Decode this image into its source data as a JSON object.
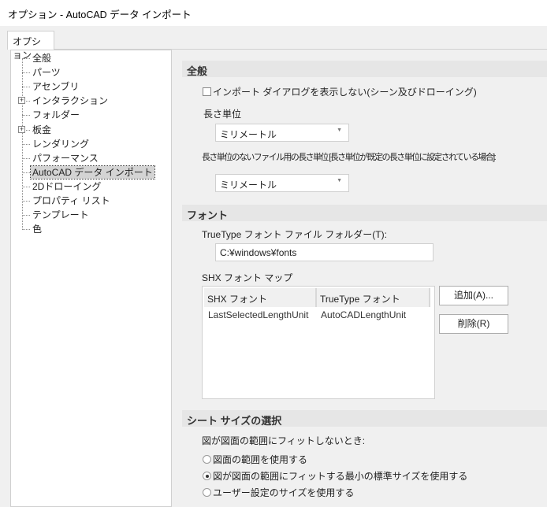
{
  "window": {
    "title": "オプション - AutoCAD データ インポート"
  },
  "tab": "オプション",
  "tree": [
    {
      "label": "全般",
      "expandable": false
    },
    {
      "label": "パーツ",
      "expandable": false
    },
    {
      "label": "アセンブリ",
      "expandable": false
    },
    {
      "label": "インタラクション",
      "expandable": true
    },
    {
      "label": "フォルダー",
      "expandable": false
    },
    {
      "label": "板金",
      "expandable": true
    },
    {
      "label": "レンダリング",
      "expandable": false
    },
    {
      "label": "パフォーマンス",
      "expandable": false
    },
    {
      "label": "AutoCAD データ インポート",
      "expandable": false,
      "selected": true
    },
    {
      "label": "2Dドローイング",
      "expandable": false
    },
    {
      "label": "プロパティ リスト",
      "expandable": false
    },
    {
      "label": "テンプレート",
      "expandable": false
    },
    {
      "label": "色",
      "expandable": false
    }
  ],
  "general": {
    "header": "全般",
    "no_dialog_checkbox": {
      "label": "インポート ダイアログを表示しない(シーン及びドローイング)",
      "checked": false
    },
    "length_unit_label": "長さ単位",
    "length_unit_value": "ミリメートル",
    "unitless_label": "長さ単位のないファイル用の長さ単位 [長さ単位が既定の長さ単位に設定されている場合]:",
    "unitless_value": "ミリメートル"
  },
  "font": {
    "header": "フォント",
    "folder_label": "TrueType フォント ファイル フォルダー(T):",
    "folder_value": "C:¥windows¥fonts",
    "map_label": "SHX フォント マップ",
    "columns": [
      "SHX フォント",
      "TrueType フォント"
    ],
    "rows": [
      [
        "LastSelectedLengthUnit",
        "AutoCADLengthUnit"
      ]
    ],
    "add_button": "追加(A)...",
    "delete_button": "削除(R)"
  },
  "sheet": {
    "header": "シート サイズの選択",
    "prompt": "図が図面の範囲にフィットしないとき:",
    "options": [
      {
        "label": "図面の範囲を使用する",
        "selected": false
      },
      {
        "label": "図が図面の範囲にフィットする最小の標準サイズを使用する",
        "selected": true
      },
      {
        "label": "ユーザー設定のサイズを使用する",
        "selected": false
      }
    ]
  }
}
